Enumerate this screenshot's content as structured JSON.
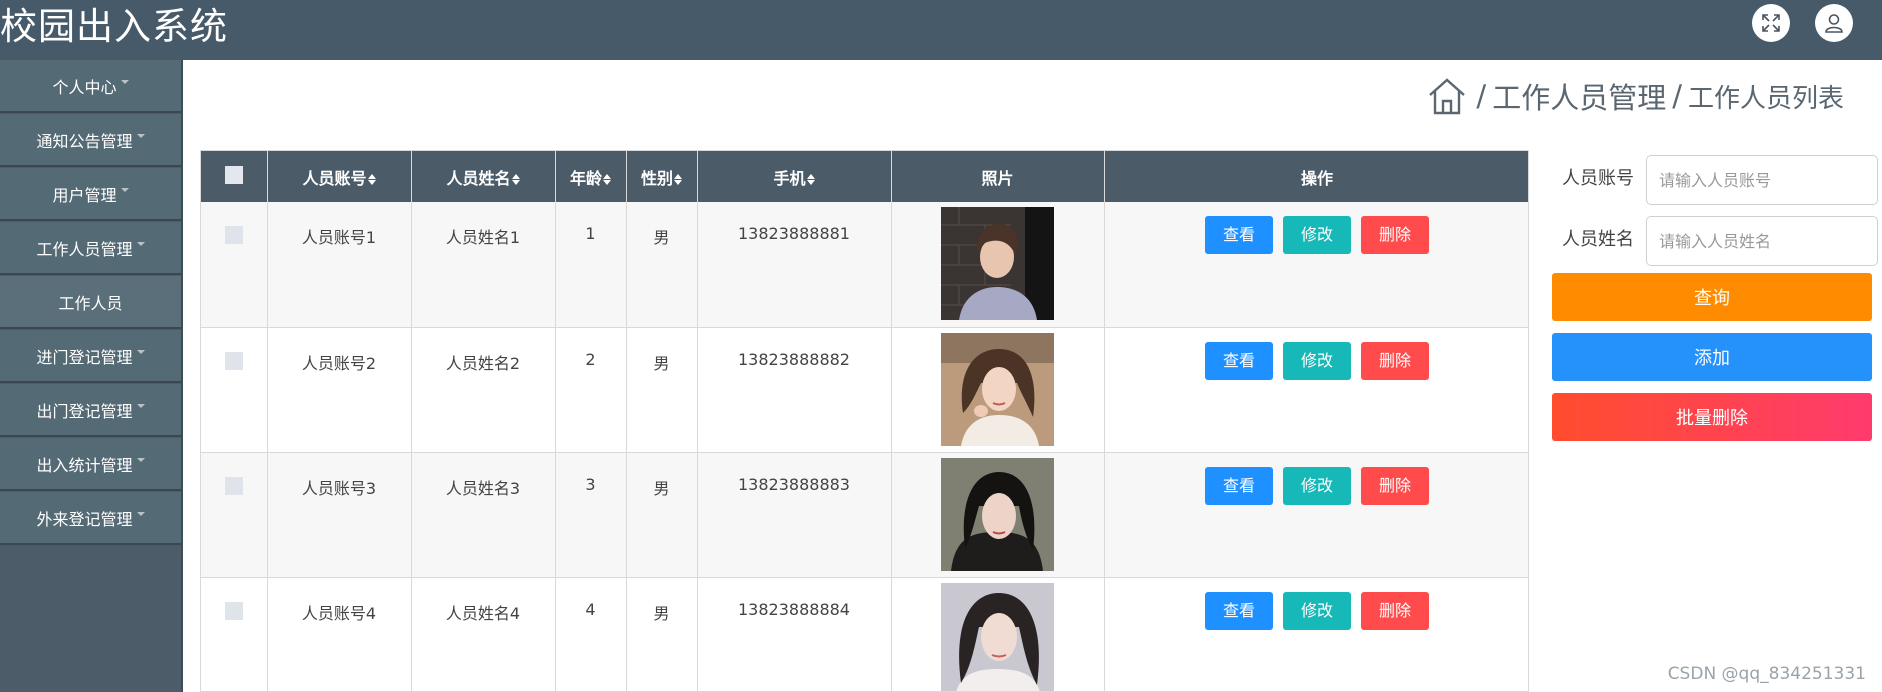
{
  "app": {
    "title": "校园出入系统"
  },
  "topbar": {
    "icons": [
      "fullscreen-icon",
      "user-icon"
    ]
  },
  "sidebar": {
    "items": [
      {
        "label": "个人中心",
        "caret": true
      },
      {
        "label": "通知公告管理",
        "caret": true
      },
      {
        "label": "用户管理",
        "caret": true
      },
      {
        "label": "工作人员管理",
        "caret": true
      },
      {
        "label": "工作人员",
        "caret": false
      },
      {
        "label": "进门登记管理",
        "caret": true
      },
      {
        "label": "出门登记管理",
        "caret": true
      },
      {
        "label": "出入统计管理",
        "caret": true
      },
      {
        "label": "外来登记管理",
        "caret": true
      }
    ]
  },
  "breadcrumb": {
    "icon": "home-icon",
    "sep": "/",
    "section": "工作人员管理",
    "page": "工作人员列表"
  },
  "table": {
    "columns": [
      "人员账号",
      "人员姓名",
      "年龄",
      "性别",
      "手机",
      "照片",
      "操作"
    ],
    "rows": [
      {
        "account": "人员账号1",
        "name": "人员姓名1",
        "age": "1",
        "gender": "男",
        "phone": "13823888881"
      },
      {
        "account": "人员账号2",
        "name": "人员姓名2",
        "age": "2",
        "gender": "男",
        "phone": "13823888882"
      },
      {
        "account": "人员账号3",
        "name": "人员姓名3",
        "age": "3",
        "gender": "男",
        "phone": "13823888883"
      },
      {
        "account": "人员账号4",
        "name": "人员姓名4",
        "age": "4",
        "gender": "男",
        "phone": "13823888884"
      }
    ],
    "actions": {
      "view": "查看",
      "edit": "修改",
      "delete": "删除"
    }
  },
  "search": {
    "account_label": "人员账号",
    "account_placeholder": "请输入人员账号",
    "name_label": "人员姓名",
    "name_placeholder": "请输入人员姓名",
    "search_button": "查询",
    "add_button": "添加",
    "bulk_delete_button": "批量删除"
  },
  "watermark": "CSDN @qq_834251331",
  "colors": {
    "topbar": "#475a69",
    "sidebar": "#546a75",
    "view": "#1e90ff",
    "edit": "#16b8b8",
    "delete": "#ff4b4b",
    "search": "#ff8c00",
    "add": "#2591fb"
  }
}
